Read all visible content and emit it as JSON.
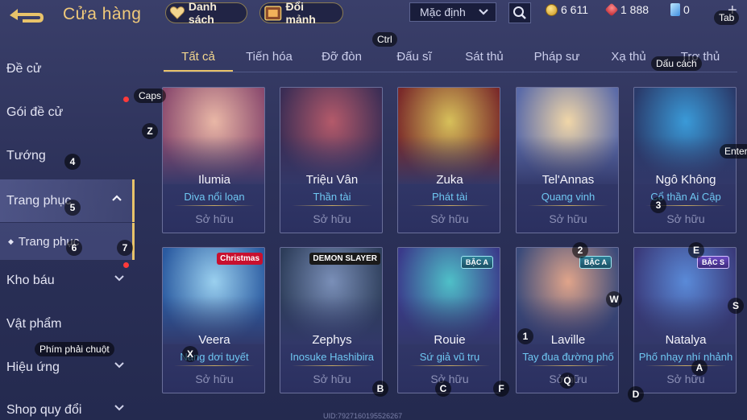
{
  "header": {
    "title": "Cửa hàng",
    "wishlist_label": "Danh sách",
    "exchange_label": "Đổi mảnh",
    "sort_selected": "Mặc định",
    "currency": {
      "gold": "6 611",
      "vouchers": "1 888",
      "diamonds": "0"
    }
  },
  "hints": {
    "tab": "Tab",
    "ctrl": "Ctrl",
    "space": "Dấu cách",
    "caps": "Caps",
    "enter": "Enter",
    "right_click": "Phím phải chuột",
    "z": "Z",
    "k4": "4",
    "k5": "5",
    "k6": "6",
    "k7": "7",
    "k3": "3",
    "k2": "2",
    "e": "E",
    "w": "W",
    "s": "S",
    "x": "X",
    "k1": "1",
    "b": "B",
    "c": "C",
    "f": "F",
    "q": "Q",
    "d": "D",
    "a": "A"
  },
  "tabs": [
    {
      "label": "Tất cả"
    },
    {
      "label": "Tiến hóa"
    },
    {
      "label": "Đỡ đòn"
    },
    {
      "label": "Đấu sĩ"
    },
    {
      "label": "Sát thủ"
    },
    {
      "label": "Pháp sư"
    },
    {
      "label": "Xạ thủ"
    },
    {
      "label": "Trợ thủ"
    }
  ],
  "sidebar": {
    "items": [
      {
        "label": "Đề cử"
      },
      {
        "label": "Gói đề cử"
      },
      {
        "label": "Tướng"
      },
      {
        "label": "Trang phục"
      },
      {
        "label": "Trang phục"
      },
      {
        "label": "Kho báu"
      },
      {
        "label": "Vật phẩm"
      },
      {
        "label": "Hiệu ứng"
      },
      {
        "label": "Shop quy đổi"
      }
    ]
  },
  "cards": [
    {
      "hero": "Ilumia",
      "skin": "Diva nổi loạn",
      "status": "Sở hữu",
      "colors": [
        "#e9b7a6",
        "#8a4a6e"
      ]
    },
    {
      "hero": "Triệu Vân",
      "skin": "Thần tài",
      "status": "Sở hữu",
      "colors": [
        "#b45a6a",
        "#3b2d55"
      ]
    },
    {
      "hero": "Zuka",
      "skin": "Phát tài",
      "status": "Sở hữu",
      "colors": [
        "#d7c05a",
        "#7a2a2a"
      ]
    },
    {
      "hero": "Tel'Annas",
      "skin": "Quang vinh",
      "status": "Sở hữu",
      "colors": [
        "#f0d6a8",
        "#5a6aa8"
      ]
    },
    {
      "hero": "Ngô Không",
      "skin": "Cổ thần Ai Cập",
      "status": "Sở hữu",
      "colors": [
        "#3a9ad8",
        "#2a3a6a"
      ]
    },
    {
      "hero": "Veera",
      "skin": "Nàng dơi tuyết",
      "status": "Sở hữu",
      "colors": [
        "#9ad0ef",
        "#2a5aa0"
      ],
      "badge": "Christmas",
      "badge_color": "#c8102e"
    },
    {
      "hero": "Zephys",
      "skin": "Inosuke Hashibira",
      "status": "Sở hữu",
      "colors": [
        "#7a8fb8",
        "#2d3d5a"
      ],
      "badge": "DEMON SLAYER",
      "badge_color": "#1a1a1a"
    },
    {
      "hero": "Rouie",
      "skin": "Sứ giả vũ trụ",
      "status": "Sở hữu",
      "colors": [
        "#4fc0c8",
        "#3a3a8a"
      ],
      "badge": "BẬC A",
      "grade": "a"
    },
    {
      "hero": "Laville",
      "skin": "Tay đua đường phố",
      "status": "Sở hữu",
      "colors": [
        "#e0a48a",
        "#3a4a7a"
      ],
      "badge": "BẬC A",
      "grade": "a"
    },
    {
      "hero": "Natalya",
      "skin": "Phố nhạy nhí nhảnh",
      "status": "Sở hữu",
      "colors": [
        "#5a8ad8",
        "#3a3a7a"
      ],
      "badge": "BẬC S",
      "grade": "s"
    }
  ],
  "footer": {
    "uid": "UID:7927160195526267"
  }
}
